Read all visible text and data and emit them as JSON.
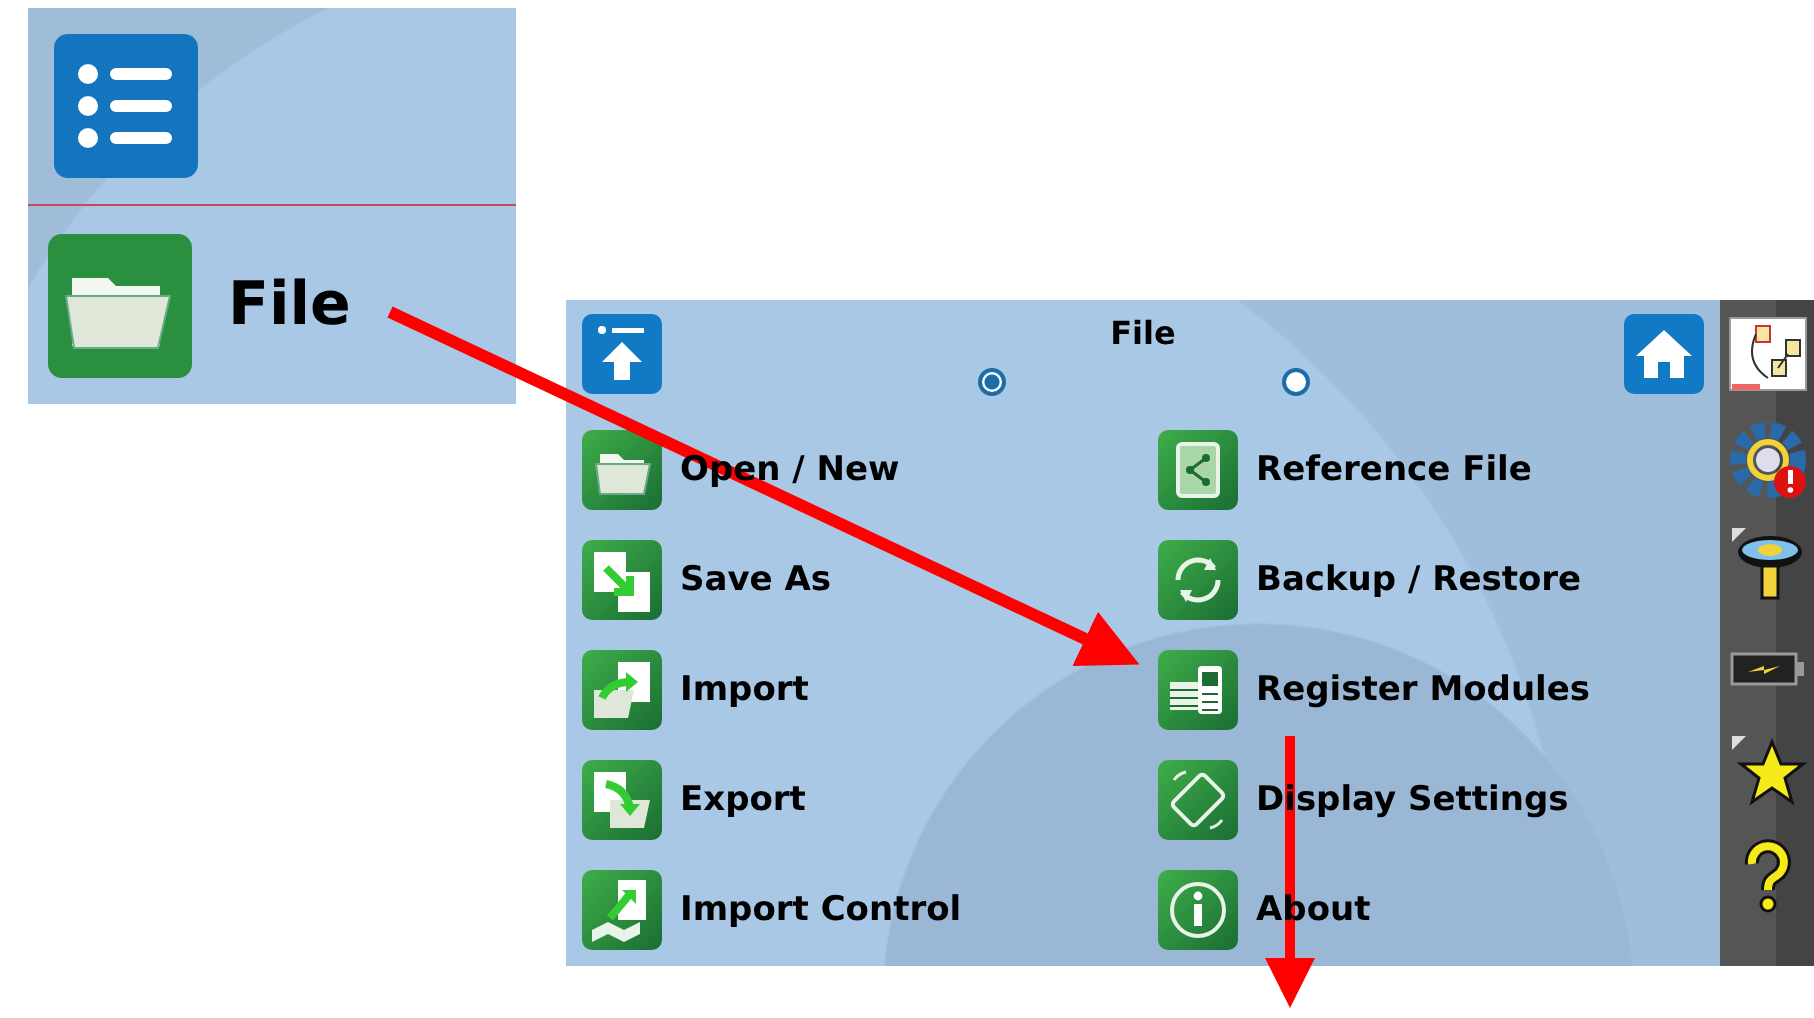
{
  "inset": {
    "label": "File"
  },
  "screen": {
    "title": "File",
    "pages": [
      {
        "selected": true
      },
      {
        "selected": false
      }
    ],
    "items": [
      {
        "label": "Open / New"
      },
      {
        "label": "Reference File"
      },
      {
        "label": "Save As"
      },
      {
        "label": "Backup / Restore"
      },
      {
        "label": "Import"
      },
      {
        "label": "Register Modules"
      },
      {
        "label": "Export"
      },
      {
        "label": "Display Settings"
      },
      {
        "label": "Import Control"
      },
      {
        "label": "About"
      }
    ]
  }
}
